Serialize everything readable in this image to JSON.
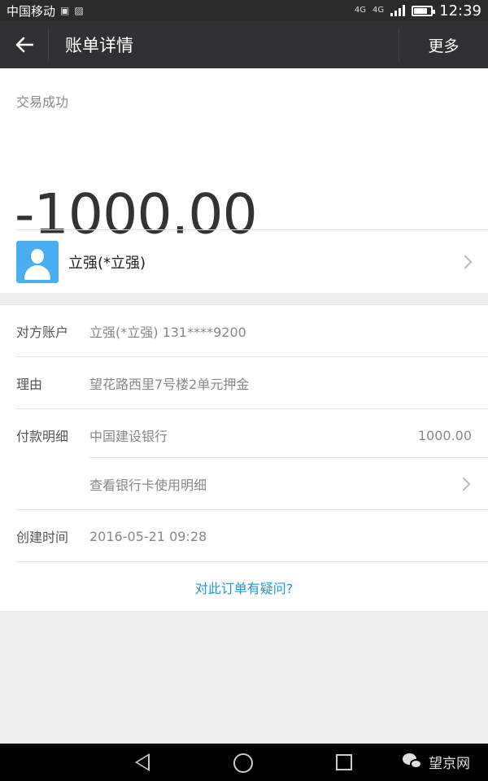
{
  "status_bar": {
    "carrier": "中国移动",
    "network_1": "4G",
    "network_2": "4G",
    "time": "12:39",
    "battery_level": 0.8
  },
  "title_bar": {
    "title": "账单详情",
    "more_label": "更多",
    "back_icon": "arrow-left-icon"
  },
  "summary": {
    "status": "交易成功",
    "amount": "-1000.00",
    "contact_name": "立强(*立强)"
  },
  "details": {
    "rows": [
      {
        "label": "对方账户",
        "value": "立强(*立强) 131****9200"
      },
      {
        "label": "理由",
        "value": "望花路西里7号楼2单元押金"
      },
      {
        "label": "付款明细",
        "value": "中国建设银行",
        "amount": "1000.00"
      },
      {
        "label": "",
        "value": "查看银行卡使用明细"
      },
      {
        "label": "创建时间",
        "value": "2016-05-21 09:28"
      }
    ],
    "question": "对此订单有疑问?"
  },
  "watermark": {
    "text": "望京网"
  },
  "colors": {
    "title_bar": "#2f3132",
    "avatar": "#49aef0",
    "link": "#1a9ad6"
  }
}
